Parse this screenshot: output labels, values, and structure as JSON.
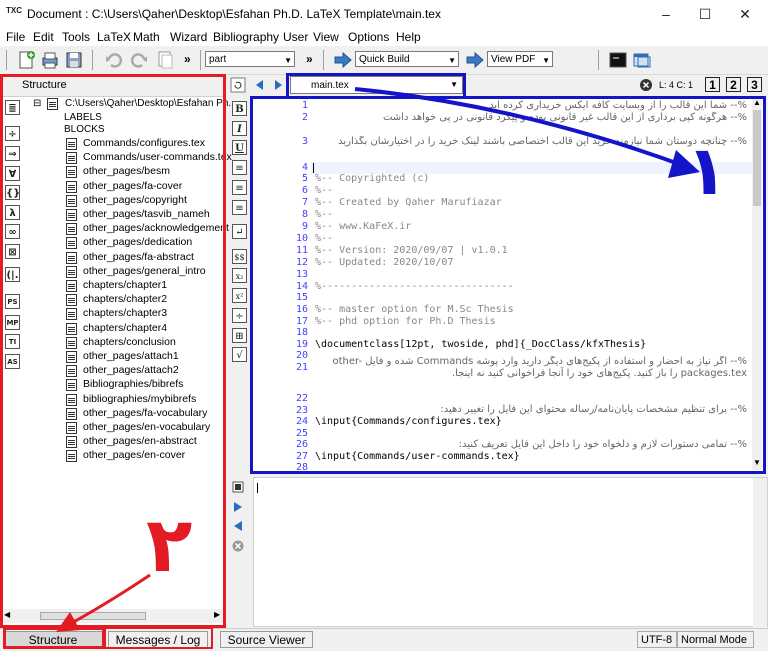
{
  "window": {
    "title": "Document : C:\\Users\\Qaher\\Desktop\\Esfahan Ph.D. LaTeX Template\\main.tex",
    "app_icon_text": "TXC",
    "minimize": "–",
    "maximize": "☐",
    "close": "✕"
  },
  "menu": [
    "File",
    "Edit",
    "Tools",
    "LaTeX",
    "Math",
    "Wizard",
    "Bibliography",
    "User",
    "View",
    "Options",
    "Help"
  ],
  "toolbar": {
    "structure_combo": "part",
    "build_combo": "Quick Build",
    "view_combo": "View PDF",
    "overflow": "»"
  },
  "structure": {
    "header": "Structure",
    "root": "C:\\Users\\Qaher\\Desktop\\Esfahan Ph.",
    "labels": "LABELS",
    "blocks": "BLOCKS",
    "files": [
      "Commands/configures.tex",
      "Commands/user-commands.tex",
      "other_pages/besm",
      "other_pages/fa-cover",
      "other_pages/copyright",
      "other_pages/tasvib_nameh",
      "other_pages/acknowledgement",
      "other_pages/dedication",
      "other_pages/fa-abstract",
      "other_pages/general_intro",
      "chapters/chapter1",
      "chapters/chapter2",
      "chapters/chapter3",
      "chapters/chapter4",
      "chapters/conclusion",
      "other_pages/attach1",
      "other_pages/attach2",
      "Bibliographies/bibrefs",
      "bibliographies/mybibrefs",
      "other_pages/fa-vocabulary",
      "other_pages/en-vocabulary",
      "other_pages/en-abstract",
      "other_pages/en-cover"
    ],
    "side_buttons": [
      "≣",
      "÷",
      "⇒",
      "∀",
      "{}",
      "λ",
      "∞",
      "⊠",
      "(|.",
      "PS",
      "MP",
      "TI",
      "AS"
    ]
  },
  "editor": {
    "tab_name": "main.tex",
    "cursor_info": "L: 4 C: 1",
    "view_buttons": [
      "1",
      "2",
      "3"
    ],
    "left_buttons": [
      "B",
      "I",
      "U",
      "≡",
      "≡",
      "≡",
      "↵",
      "$$",
      "x₂",
      "x²",
      "÷",
      "⊞",
      "√"
    ],
    "line_numbers": [
      "1",
      "2",
      "3",
      "4",
      "5",
      "6",
      "7",
      "8",
      "9",
      "10",
      "11",
      "12",
      "13",
      "14",
      "15",
      "16",
      "17",
      "18",
      "19",
      "20",
      "21",
      "22",
      "23",
      "24",
      "25",
      "26",
      "27",
      "28"
    ],
    "lines": [
      "%-- Copyrighted (c)",
      "%--",
      "%-- Created by Qaher Marufiazar",
      "%--",
      "%-- www.KaFeX.ir",
      "%--",
      "%-- Version: 2020/09/07 | v1.0.1",
      "%-- Updated: 2020/10/07",
      "%--------------------------------",
      "%-- master option for M.Sc Thesis",
      "%-- phd    option for Ph.D Thesis",
      "\\documentclass[12pt, twoside, phd]{_DocClass/kfxThesis}",
      "\\input{Commands/configures.tex}",
      "\\input{Commands/user-commands.tex}"
    ],
    "rtl_lines": [
      "%-- شما این قالب را از وبسایت کافه ایکس خریداری کرده اید",
      "%-- هرگونه کپی برداری از این قالب غیر قانونی بوده و پیگرد قانونی در پی خواهد داشت",
      "%-- چنانچه دوستان شما نیازمند خرید این قالب اختصاصی باشند لینک خرید را در اختیارشان بگذارید",
      "%-- اگر نیاز به احضار و استفاده از پکیج‌های دیگر دارید وارد پوشه Commands شده و فایل other-packages.tex را باز کنید. پکیج‌های خود را آنجا فراخوانی کنید نه اینجا.",
      "%-- برای تنظیم مشخصات پایان‌نامه/رساله محتوای این فایل را تغییر دهید:",
      "%-- تمامی دستورات لازم و دلخواه خود را داخل این فایل تعریف کنید:"
    ]
  },
  "bottom_tabs": [
    "Structure",
    "Messages / Log",
    "Source Viewer"
  ],
  "status": {
    "encoding": "UTF-8",
    "mode": "Normal Mode"
  },
  "annotations": {
    "one": "۱",
    "two": "۲"
  }
}
